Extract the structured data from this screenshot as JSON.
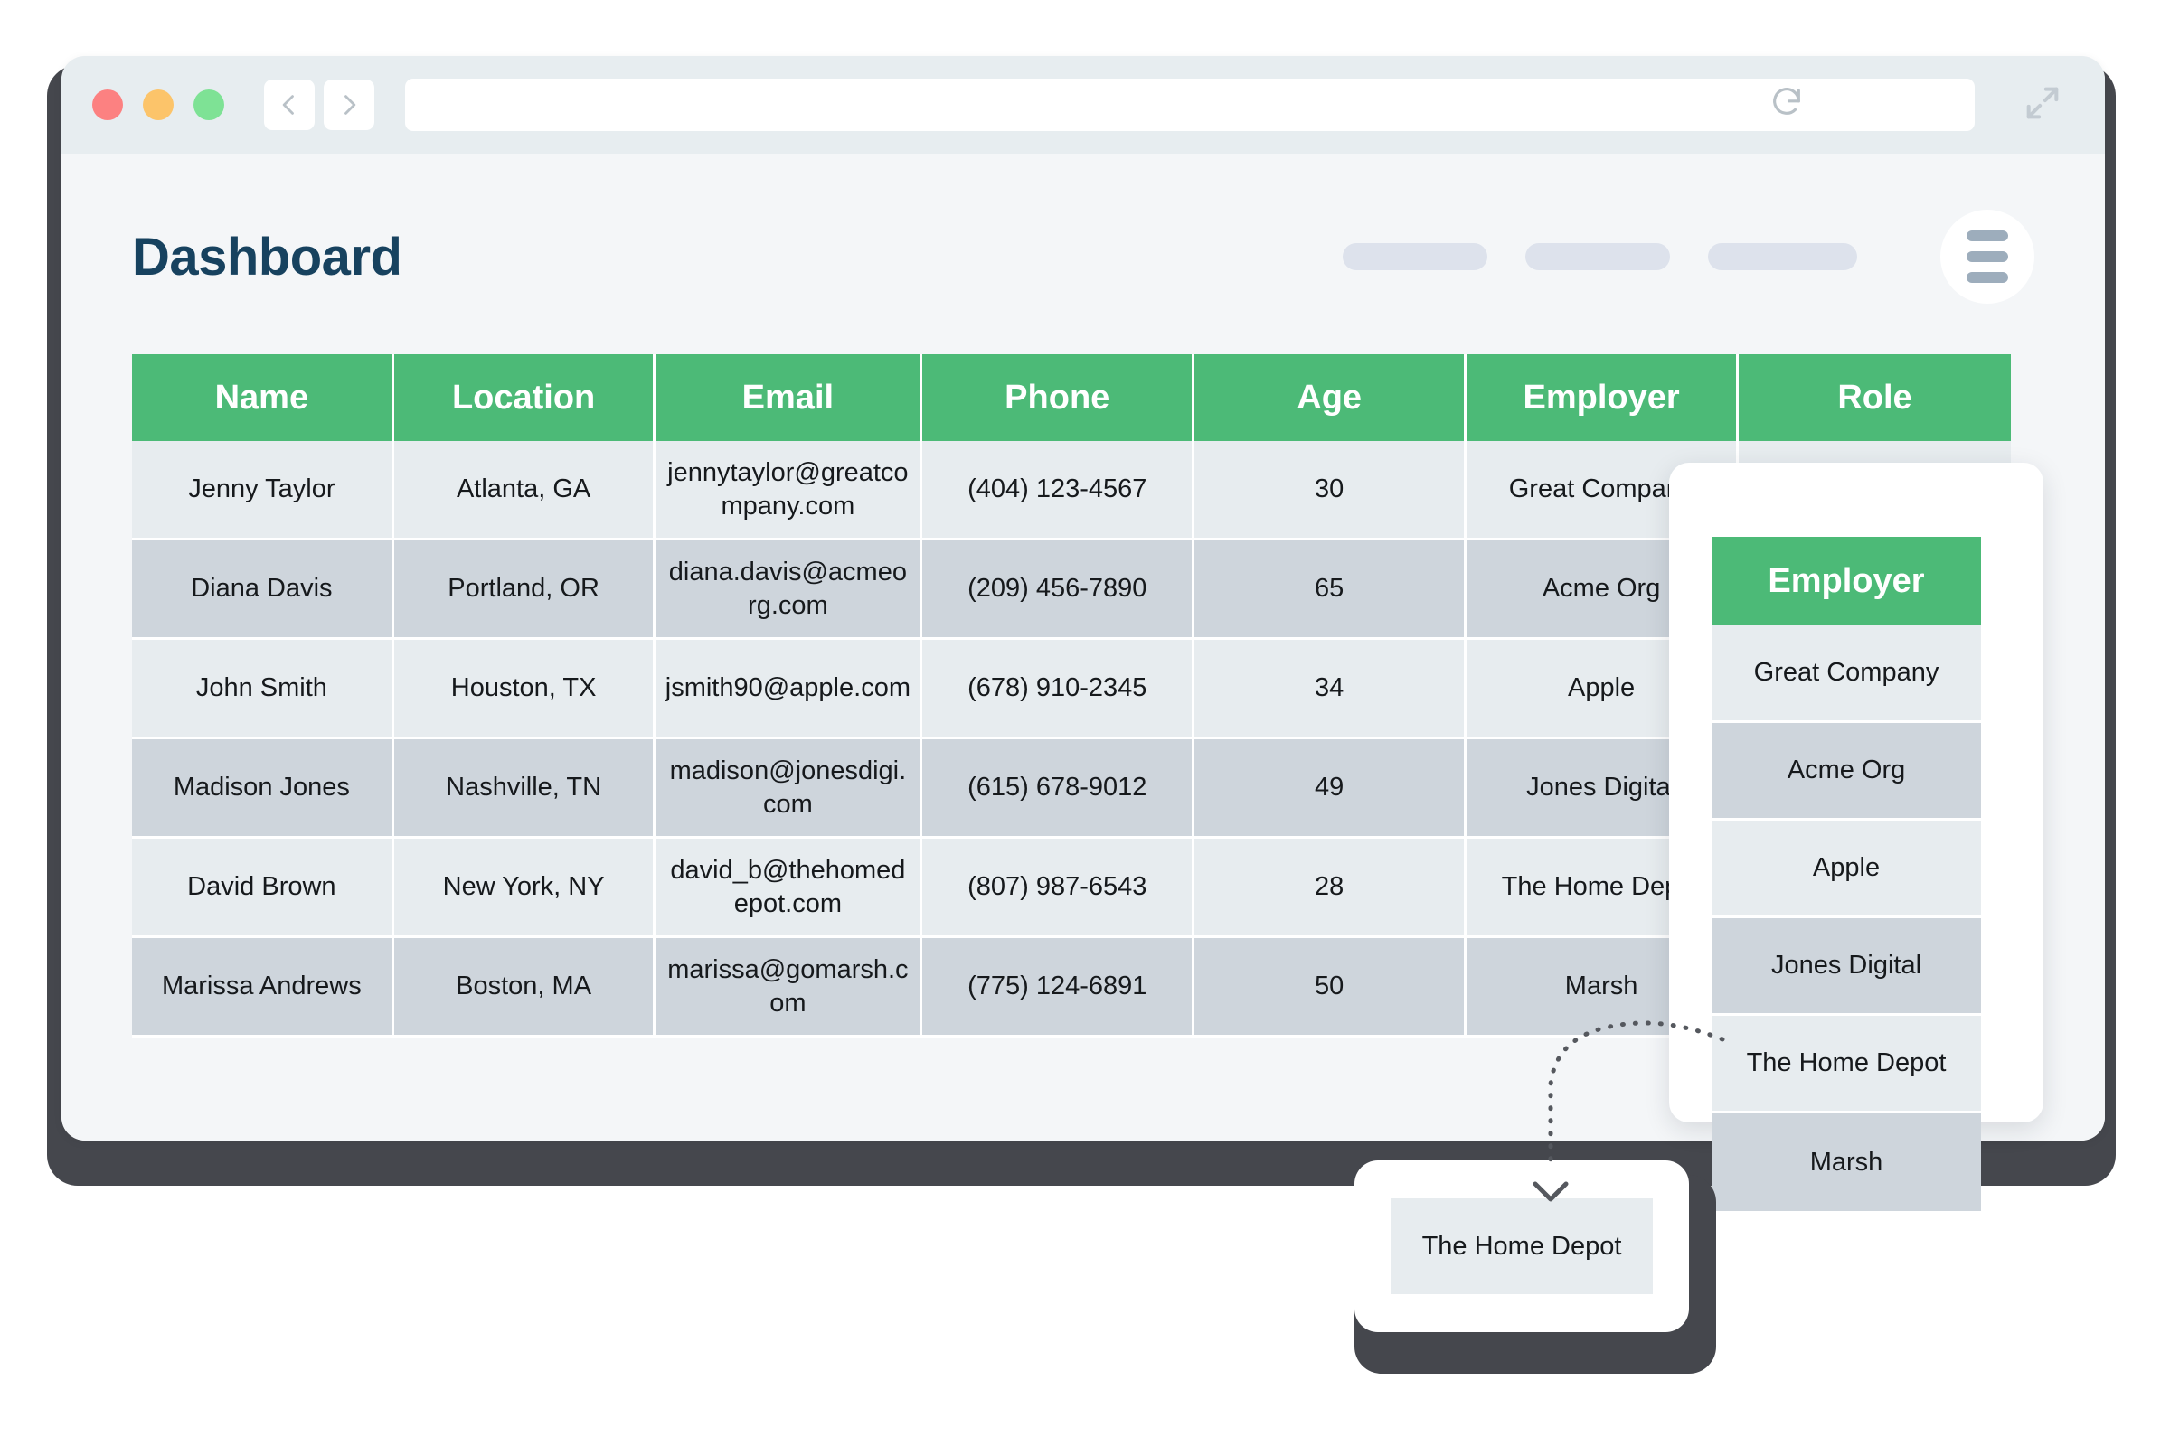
{
  "browser": {
    "traffic_lights": [
      "close",
      "minimize",
      "maximize"
    ],
    "back_label": "Back",
    "forward_label": "Forward",
    "url_value": "",
    "url_placeholder": "",
    "reload_label": "Reload",
    "expand_label": "Enter full screen"
  },
  "header": {
    "title": "Dashboard",
    "nav_pills": [
      "",
      "",
      ""
    ],
    "menu_label": "Menu"
  },
  "table": {
    "columns": [
      "Name",
      "Location",
      "Email",
      "Phone",
      "Age",
      "Employer",
      "Role"
    ],
    "rows": [
      {
        "name": "Jenny Taylor",
        "location": "Atlanta, GA",
        "email": "jennytaylor@greatcompany.com",
        "phone": "(404) 123-4567",
        "age": "30",
        "employer": "Great Company",
        "role": ""
      },
      {
        "name": "Diana Davis",
        "location": "Portland, OR",
        "email": "diana.davis@acmeorg.com",
        "phone": "(209) 456-7890",
        "age": "65",
        "employer": "Acme Org",
        "role": ""
      },
      {
        "name": "John Smith",
        "location": "Houston, TX",
        "email": "jsmith90@apple.com",
        "phone": "(678) 910-2345",
        "age": "34",
        "employer": "Apple",
        "role": ""
      },
      {
        "name": "Madison Jones",
        "location": "Nashville, TN",
        "email": "madison@jonesdigi.com",
        "phone": "(615) 678-9012",
        "age": "49",
        "employer": "Jones Digital",
        "role": ""
      },
      {
        "name": "David Brown",
        "location": "New York, NY",
        "email": "david_b@thehomedepot.com",
        "phone": "(807) 987-6543",
        "age": "28",
        "employer": "The Home Depot",
        "role": ""
      },
      {
        "name": "Marissa Andrews",
        "location": "Boston, MA",
        "email": "marissa@gomarsh.com",
        "phone": "(775) 124-6891",
        "age": "50",
        "employer": "Marsh",
        "role": ""
      }
    ]
  },
  "employer_panel": {
    "header": "Employer",
    "values": [
      "Great Company",
      "Acme Org",
      "Apple",
      "Jones Digital",
      "The Home Depot",
      "Marsh"
    ]
  },
  "callout": {
    "value": "The Home Depot"
  },
  "colors": {
    "accent_green": "#4cba77",
    "title_navy": "#17425f",
    "row_light": "#e7ecef",
    "row_dark": "#ced5dc",
    "frame_dark": "#45474d",
    "chrome": "#e7edf0",
    "page_bg": "#f4f6f8"
  }
}
